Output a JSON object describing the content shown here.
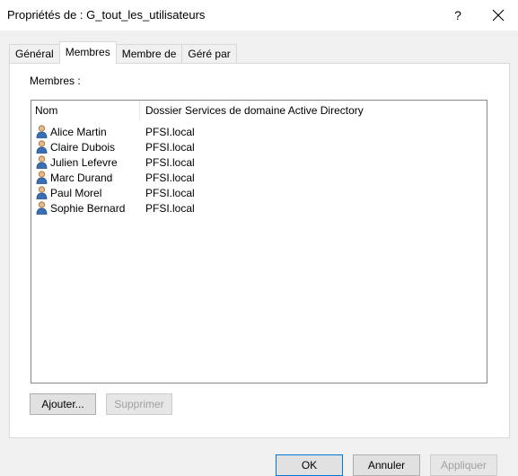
{
  "window": {
    "title": "Propriétés de : G_tout_les_utilisateurs",
    "help_label": "?"
  },
  "tabs": [
    {
      "label": "Général",
      "active": false
    },
    {
      "label": "Membres",
      "active": true
    },
    {
      "label": "Membre de",
      "active": false
    },
    {
      "label": "Géré par",
      "active": false
    }
  ],
  "members": {
    "section_label": "Membres :",
    "columns": [
      "Nom",
      "Dossier Services de domaine Active Directory"
    ],
    "rows": [
      {
        "name": "Alice Martin",
        "folder": "PFSI.local",
        "icon": "user-icon"
      },
      {
        "name": "Claire Dubois",
        "folder": "PFSI.local",
        "icon": "user-icon"
      },
      {
        "name": "Julien Lefevre",
        "folder": "PFSI.local",
        "icon": "user-icon"
      },
      {
        "name": "Marc Durand",
        "folder": "PFSI.local",
        "icon": "user-icon"
      },
      {
        "name": "Paul Morel",
        "folder": "PFSI.local",
        "icon": "user-icon"
      },
      {
        "name": "Sophie Bernard",
        "folder": "PFSI.local",
        "icon": "user-icon"
      }
    ]
  },
  "actions": {
    "add_label": "Ajouter...",
    "remove_label": "Supprimer"
  },
  "footer": {
    "ok_label": "OK",
    "cancel_label": "Annuler",
    "apply_label": "Appliquer"
  }
}
